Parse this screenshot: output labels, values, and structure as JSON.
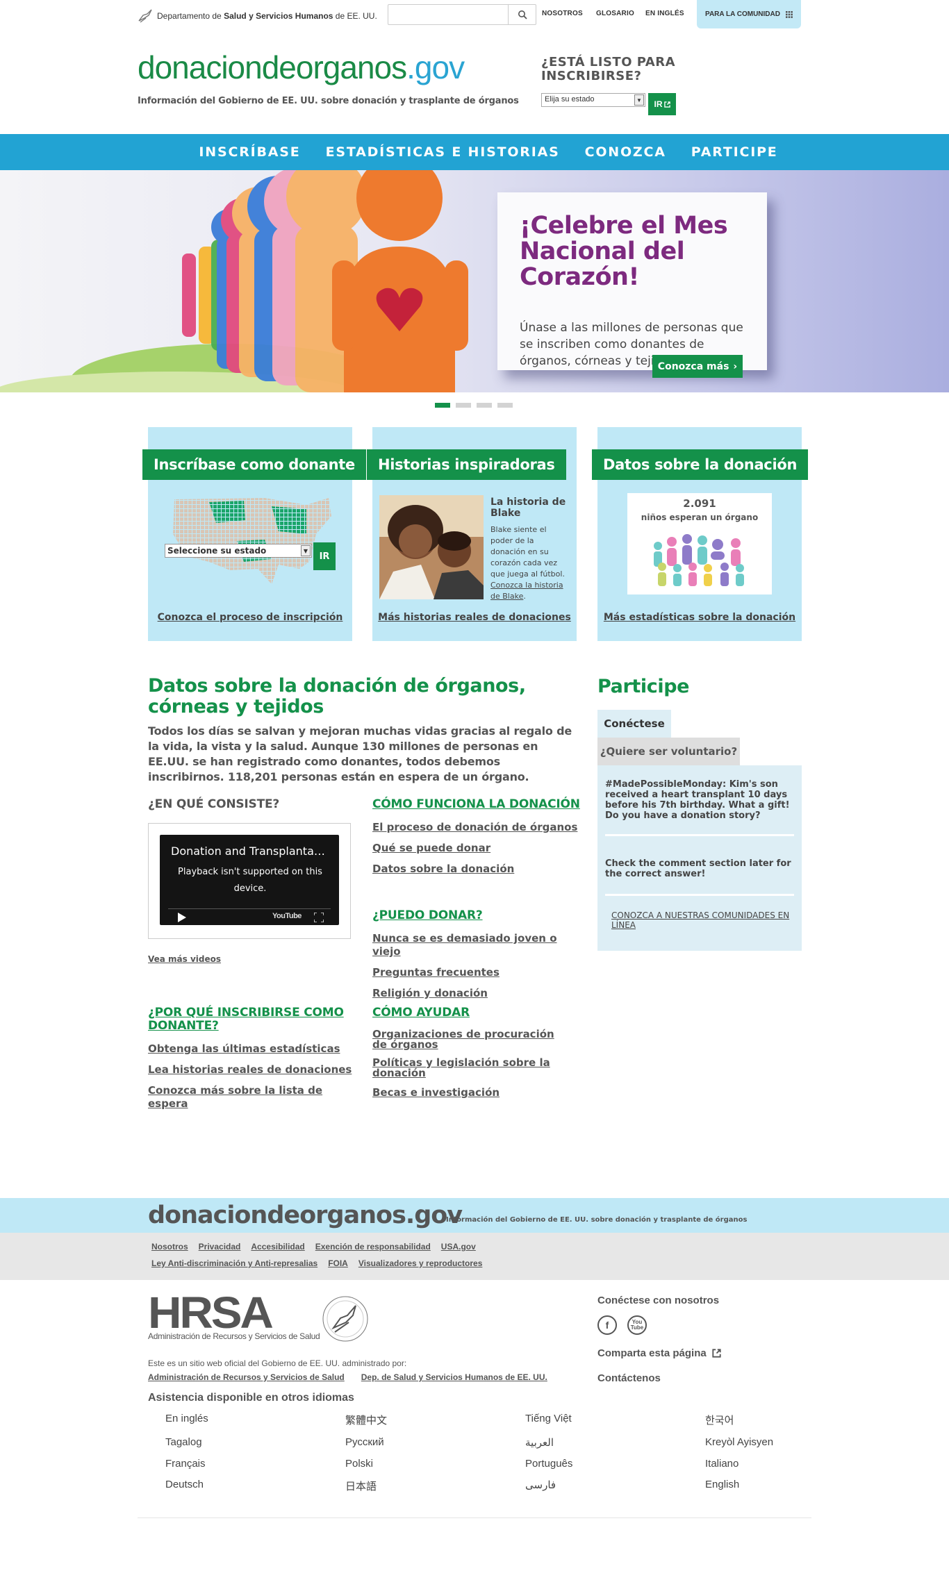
{
  "topbar": {
    "hhs_prefix": "Departamento de ",
    "hhs_bold": "Salud y Servicios Humanos",
    "hhs_suffix": " de EE. UU.",
    "search_placeholder": "",
    "links": [
      "NOSOTROS",
      "GLOSARIO",
      "EN INGLÉS"
    ],
    "community": "PARA LA COMUNIDAD"
  },
  "header": {
    "logo_main": "donaciondeorganos",
    "logo_tld": ".gov",
    "tagline": "Información del Gobierno de EE. UU. sobre donación y trasplante de órganos",
    "ready_line1": "¿ESTÁ LISTO PARA",
    "ready_line2": "INSCRIBIRSE?",
    "state_select": "Elija su estado",
    "go": "IR"
  },
  "nav": [
    "INSCRÍBASE",
    "ESTADÍSTICAS E HISTORIAS",
    "CONOZCA",
    "PARTICIPE"
  ],
  "hero": {
    "title": "¡Celebre el Mes Nacional del Corazón!",
    "text": "Únase a las millones de personas que se inscriben como donantes de órganos, córneas y tejidos.",
    "button": "Conozca más",
    "slide_count": 4,
    "active_slide": 1
  },
  "features": {
    "register": {
      "heading": "Inscríbase como donante",
      "select": "Seleccione su estado",
      "go": "IR",
      "link": "Conozca el proceso de inscripción"
    },
    "stories": {
      "heading": "Historias inspiradoras",
      "story_title": "La historia de Blake",
      "story_text": "Blake siente el poder de la donación en su corazón cada vez que juega al fútbol.",
      "story_link": "Conozca la historia de Blake",
      "link": "Más historias reales de donaciones"
    },
    "facts": {
      "heading": "Datos sobre la donación",
      "number": "2.091",
      "caption": "niños esperan un órgano",
      "link": "Más estadísticas sobre la donación"
    }
  },
  "main": {
    "title": "Datos sobre la donación de órganos, córneas y tejidos",
    "intro": "Todos los días se salvan y mejoran muchas vidas gracias al regalo de la vida, la vista y la salud. Aunque 130 millones de personas en EE.UU. se han registrado como donantes, todos debemos inscribirnos. 118,201 personas están en espera de un órgano.",
    "que_consiste": "¿EN QUÉ CONSISTE?",
    "video_title": "Donation and Transplanta…",
    "video_msg": "Playback isn't supported on this device.",
    "video_brand": "YouTube",
    "more_videos": "Vea más videos",
    "como_funciona": {
      "heading": "CÓMO FUNCIONA LA DONACIÓN",
      "links": [
        "El proceso de donación de órganos",
        "Qué se puede donar",
        "Datos sobre la donación"
      ]
    },
    "puedo_donar": {
      "heading": "¿PUEDO DONAR?",
      "links": [
        "Nunca se es demasiado joven o viejo",
        "Preguntas frecuentes",
        "Religión y donación"
      ]
    },
    "por_que": {
      "heading": "¿POR QUÉ INSCRIBIRSE COMO DONANTE?",
      "links": [
        "Obtenga las últimas estadísticas",
        "Lea historias reales de donaciones",
        "Conozca más sobre la lista de espera"
      ]
    },
    "como_ayudar": {
      "heading": "CÓMO AYUDAR",
      "links": [
        "Organizaciones de procuración de órganos",
        "Políticas y legislación sobre la donación",
        "Becas e investigación"
      ]
    }
  },
  "participe": {
    "title": "Participe",
    "tab_active": "Conéctese",
    "tab_inactive": "¿Quiere ser voluntario?",
    "post1": "#MadePossibleMonday: Kim's son received a heart transplant 10 days before his 7th birthday. What a gift! Do you have a donation story?",
    "post2": "Check the comment section later for the correct answer!",
    "link": "CONOZCA A NUESTRAS COMUNIDADES EN LÍNEA"
  },
  "footer": {
    "logo": "donaciondeorganos.gov",
    "tagline": "Información del Gobierno de EE. UU. sobre donación y trasplante de órganos",
    "links_row1": [
      "Nosotros",
      "Privacidad",
      "Accesibilidad",
      "Exención de responsabilidad",
      "USA.gov"
    ],
    "links_row2": [
      "Ley Anti-discriminación y Anti-represalias",
      "FOIA",
      "Visualizadores y reproductores"
    ],
    "hrsa": "HRSA",
    "hrsa_sub": "Administración de Recursos y Servicios de Salud",
    "official": "Este es un sitio web oficial del Gobierno de EE. UU. administrado por:",
    "admin_links": [
      "Administración de Recursos y Servicios de Salud",
      "Dep. de Salud y Servicios Humanos de EE. UU."
    ],
    "assist": "Asistencia disponible en otros idiomas",
    "languages": [
      "En inglés",
      "繁體中文",
      "Tiếng Việt",
      "한국어",
      "Tagalog",
      "Русский",
      "العربية",
      "Kreyòl Ayisyen",
      "Français",
      "Polski",
      "Português",
      "Italiano",
      "Deutsch",
      "日本語",
      "فارسی",
      "English"
    ],
    "connect": "Conéctese con nosotros",
    "share": "Comparta esta página",
    "contact": "Contáctenos"
  },
  "colors": {
    "green": "#14914a",
    "nav_blue": "#22a3d3",
    "light_blue": "#bfe8f6",
    "purple": "#7d2a7f"
  }
}
